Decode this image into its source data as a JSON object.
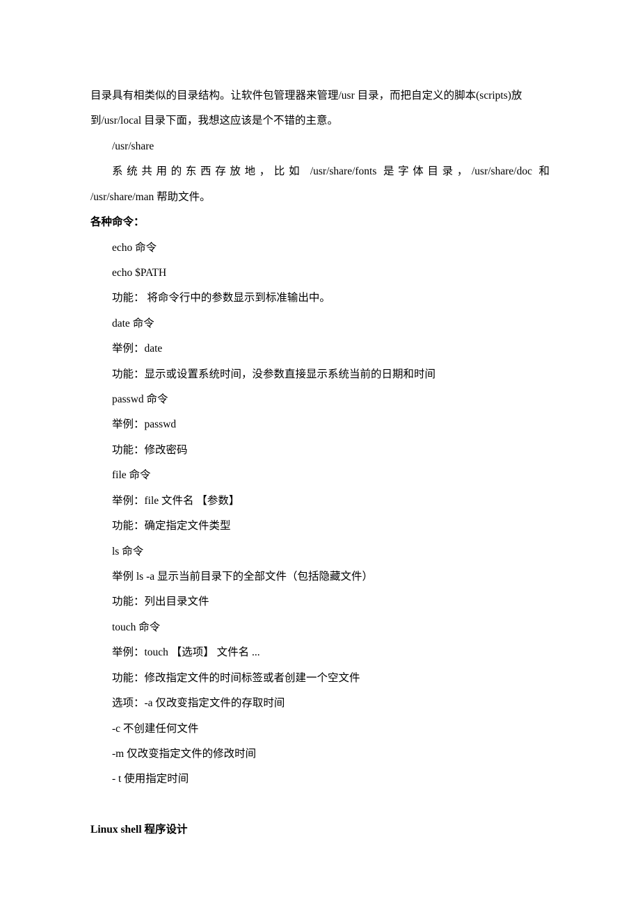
{
  "p1": "目录具有相类似的目录结构。让软件包管理器来管理/usr 目录，而把自定义的脚本(scripts)放到/usr/local 目录下面，我想这应该是个不错的主意。",
  "p2": "/usr/share",
  "p3": "系统共用的东西存放地，比如 /usr/share/fonts 是字体目录，/usr/share/doc 和",
  "p4": "/usr/share/man 帮助文件。",
  "heading1": "各种命令：",
  "cmd": {
    "echo1": "echo 命令",
    "echo2": "echo $PATH",
    "echo3": "功能： 将命令行中的参数显示到标准输出中。",
    "date1": "date 命令",
    "date2": "举例：date",
    "date3": "功能：显示或设置系统时间，没参数直接显示系统当前的日期和时间",
    "passwd1": "passwd 命令",
    "passwd2": "举例：passwd",
    "passwd3": "功能：修改密码",
    "file1": "file 命令",
    "file2": "举例：file 文件名 【参数】",
    "file3": "功能：确定指定文件类型",
    "ls1": "ls 命令",
    "ls2": "举例 ls -a 显示当前目录下的全部文件（包括隐藏文件）",
    "ls3": "功能：列出目录文件",
    "touch1": "touch 命令",
    "touch2": "举例：touch 【选项】 文件名 ...",
    "touch3": "功能：修改指定文件的时间标签或者创建一个空文件",
    "touch4": "选项：-a 仅改变指定文件的存取时间",
    "touch5": "-c 不创建任何文件",
    "touch6": "-m 仅改变指定文件的修改时间",
    "touch7": "- t 使用指定时间"
  },
  "heading2": "Linux shell 程序设计"
}
